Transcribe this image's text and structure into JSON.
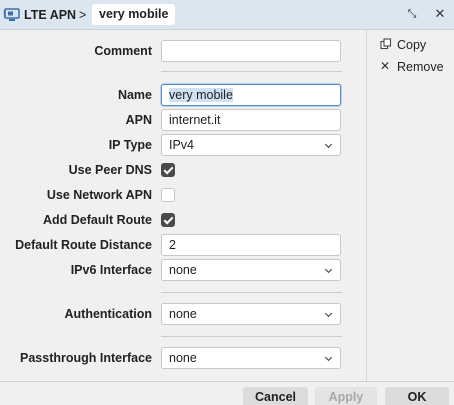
{
  "window": {
    "title": "LTE APN",
    "separator": ">",
    "item_name": "very mobile"
  },
  "form": {
    "comment": {
      "label": "Comment",
      "value": ""
    },
    "name": {
      "label": "Name",
      "value": "very mobile"
    },
    "apn": {
      "label": "APN",
      "value": "internet.it"
    },
    "ip_type": {
      "label": "IP Type",
      "value": "IPv4"
    },
    "use_peer_dns": {
      "label": "Use Peer DNS",
      "checked": true
    },
    "use_network_apn": {
      "label": "Use Network APN",
      "checked": false
    },
    "add_default_route": {
      "label": "Add Default Route",
      "checked": true
    },
    "default_route_distance": {
      "label": "Default Route Distance",
      "value": "2"
    },
    "ipv6_interface": {
      "label": "IPv6 Interface",
      "value": "none"
    },
    "authentication": {
      "label": "Authentication",
      "value": "none"
    },
    "passthrough_interface": {
      "label": "Passthrough Interface",
      "value": "none"
    }
  },
  "side_actions": [
    {
      "label": "Copy",
      "icon": "copy-icon"
    },
    {
      "label": "Remove",
      "icon": "close-icon"
    }
  ],
  "footer": {
    "cancel": "Cancel",
    "apply": "Apply",
    "ok": "OK"
  }
}
